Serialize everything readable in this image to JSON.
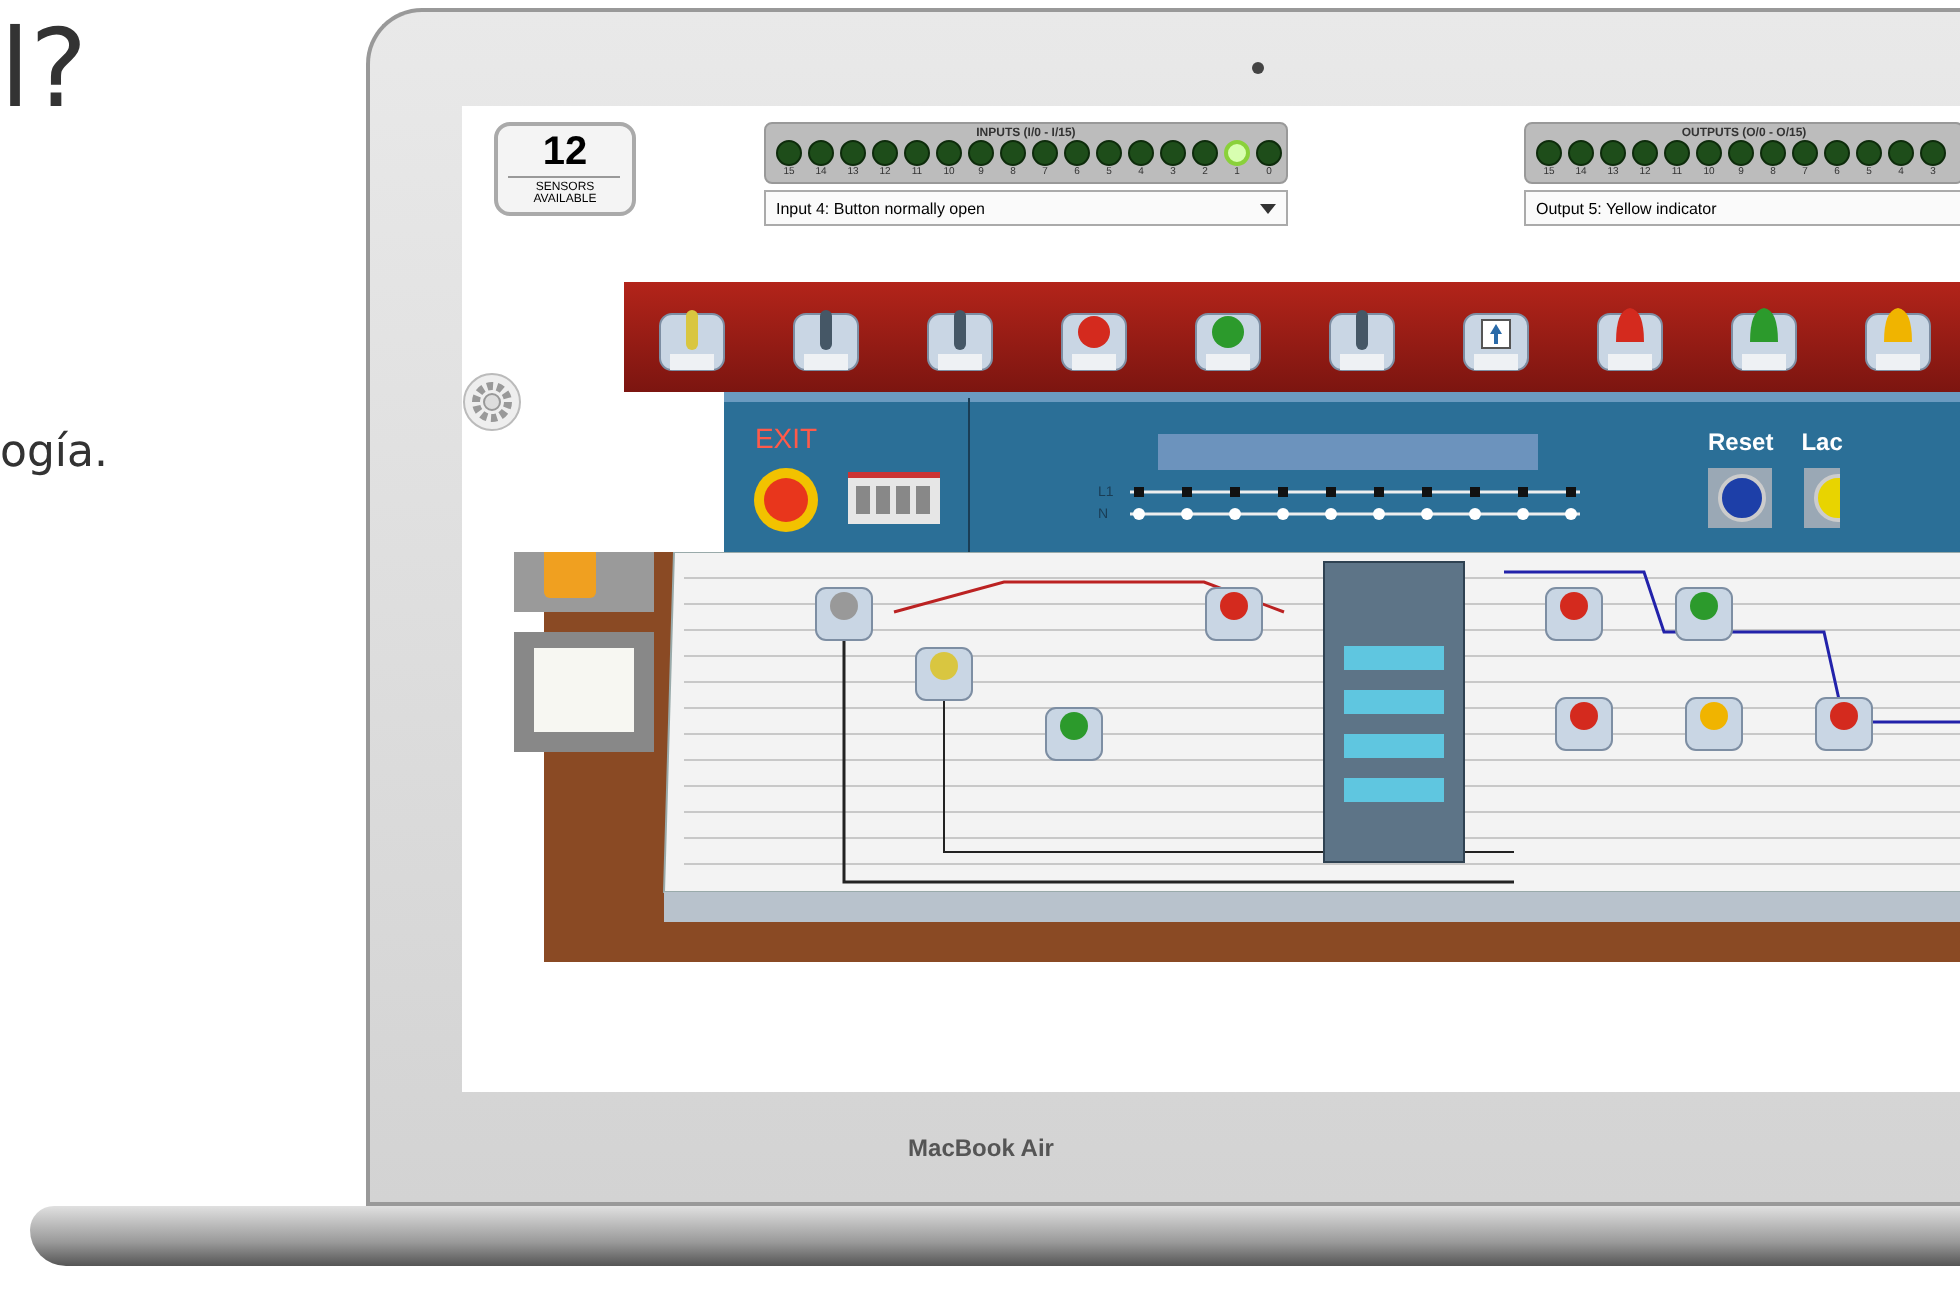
{
  "page": {
    "heading": "l?",
    "paragraph": "ogía."
  },
  "laptop": {
    "label": "MacBook Air"
  },
  "sensors": {
    "count": "12",
    "caption": "SENSORS AVAILABLE"
  },
  "inputs": {
    "title": "INPUTS (I/0 - I/15)",
    "dropdown": "Input 4: Button normally open",
    "leds": [
      {
        "label": "15",
        "on": false
      },
      {
        "label": "14",
        "on": false
      },
      {
        "label": "13",
        "on": false
      },
      {
        "label": "12",
        "on": false
      },
      {
        "label": "11",
        "on": false
      },
      {
        "label": "10",
        "on": false
      },
      {
        "label": "9",
        "on": false
      },
      {
        "label": "8",
        "on": false
      },
      {
        "label": "7",
        "on": false
      },
      {
        "label": "6",
        "on": false
      },
      {
        "label": "5",
        "on": false
      },
      {
        "label": "4",
        "on": false
      },
      {
        "label": "3",
        "on": false
      },
      {
        "label": "2",
        "on": false
      },
      {
        "label": "1",
        "on": true
      },
      {
        "label": "0",
        "on": false
      }
    ]
  },
  "outputs": {
    "title": "OUTPUTS (O/0 - O/15)",
    "dropdown": "Output 5: Yellow indicator",
    "leds": [
      {
        "label": "15",
        "on": false
      },
      {
        "label": "14",
        "on": false
      },
      {
        "label": "13",
        "on": false
      },
      {
        "label": "12",
        "on": false
      },
      {
        "label": "11",
        "on": false
      },
      {
        "label": "10",
        "on": false
      },
      {
        "label": "9",
        "on": false
      },
      {
        "label": "8",
        "on": false
      },
      {
        "label": "7",
        "on": false
      },
      {
        "label": "6",
        "on": false
      },
      {
        "label": "5",
        "on": false
      },
      {
        "label": "4",
        "on": false
      },
      {
        "label": "3",
        "on": false
      }
    ]
  },
  "shelf": [
    {
      "kind": "key"
    },
    {
      "kind": "selector"
    },
    {
      "kind": "selector"
    },
    {
      "kind": "red-button"
    },
    {
      "kind": "green-button"
    },
    {
      "kind": "selector"
    },
    {
      "kind": "arrow"
    },
    {
      "kind": "red-lamp"
    },
    {
      "kind": "green-lamp"
    },
    {
      "kind": "yellow-lamp"
    }
  ],
  "panel": {
    "exit": "EXIT",
    "l1": "L1",
    "n": "N",
    "reset": "Reset",
    "lamp": "Lac"
  }
}
